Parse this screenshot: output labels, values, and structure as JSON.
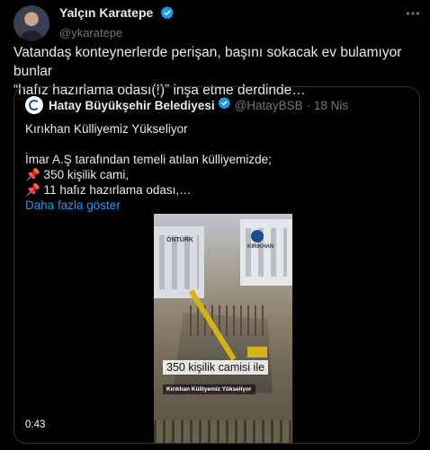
{
  "author": {
    "name": "Yalçın Karatepe",
    "handle": "@ykaratepe"
  },
  "tweet": {
    "line1": "Vatandaş konteynerlerde perişan, başını sokacak ev bulamıyor bunlar",
    "line2": "“hafız hazırlama odası(!)” inşa etme derdinde…"
  },
  "quoted": {
    "name": "Hatay Büyükşehir Belediyesi",
    "handle": "@HatayBSB",
    "date": "· 18 Nis",
    "title": "Kırıkhan Külliyemiz Yükseliyor",
    "line1": "İmar A.Ş tarafından temeli atılan külliyemizde;",
    "line2": "📌 350 kişilik cami,",
    "line3": "📌 11 hafız hazırlama odası,…",
    "show_more": "Daha fazla göster",
    "video": {
      "caption_main": "350 kişilik camisi ile",
      "caption_sub": "Kırıkhan Külliyemiz Yükseliyor",
      "logo_left": "ÖNTÜRK",
      "logo_right": "KIRIKHAN",
      "duration": "0:43"
    }
  },
  "colors": {
    "background": "#000000",
    "text": "#e7e9ea",
    "muted": "#71767b",
    "link": "#1d9bf0",
    "verified": "#1d9bf0",
    "border": "#2f3336"
  },
  "icons": {
    "verified": "verified-badge-icon",
    "more": "more-options-icon"
  }
}
